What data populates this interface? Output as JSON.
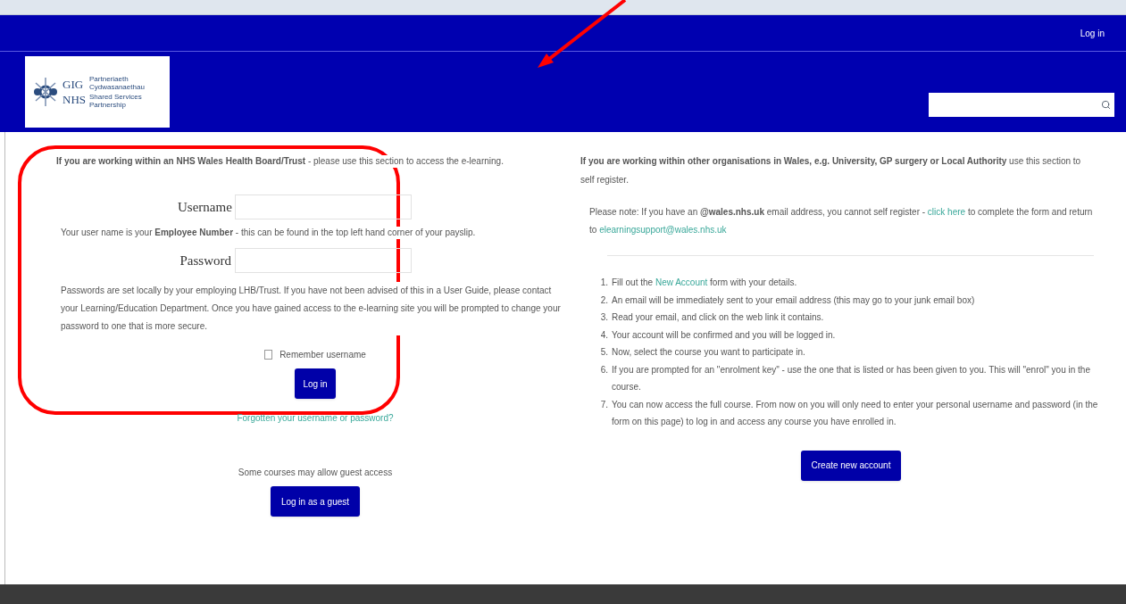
{
  "topbar": {
    "login_link": "Log in"
  },
  "logo": {
    "welsh_mark": "GIG",
    "english_mark": "NHS",
    "welsh_name": "Partneriaeth Cydwasanaethau",
    "english_name": "Shared Services Partnership"
  },
  "left": {
    "intro": "**If you are working within an NHS Wales Health Board/Trust** - please use this section to access the e-learning.",
    "username_label": "Username",
    "username_note": "Your user name is your **Employee Number** - this can be found in the top left hand corner of your payslip.",
    "password_label": "Password",
    "password_note": "Passwords are set locally by your employing LHB/Trust. If you have not been advised of this in a User Guide, please contact your Learning/Education Department. Once you have gained access to the e-learning site you will be prompted to change your password to one that is more secure.",
    "remember": {
      "label": "Remember username",
      "checked": false
    },
    "login_button": "Log in",
    "forgot_link": "Forgotten your username or password?",
    "guest_note": "Some courses may allow guest access",
    "guest_button": "Log in as a guest"
  },
  "right": {
    "intro": "**If you are working within other organisations in Wales, e.g. University, GP surgery or Local Authority** use this section to self register.",
    "note": {
      "before": "Please note: If you have an **@wales.nhs.uk** email address, you cannot self register - ",
      "link": "click here",
      "middle": " to complete the form and return to ",
      "email": "elearningsupport@wales.nhs.uk"
    },
    "steps": [
      {
        "number": "1.",
        "before": "Fill out the ",
        "link": "New Account",
        "after": " form with your details."
      },
      {
        "number": "2.",
        "before": "An email will be immediately sent to your email address (this may go to your junk email box)"
      },
      {
        "number": "3.",
        "before": "Read your email, and click on the web link it contains."
      },
      {
        "number": "4.",
        "before": "Your account will be confirmed and you will be logged in."
      },
      {
        "number": "5.",
        "before": "Now, select the course you want to participate in."
      },
      {
        "number": "6.",
        "before": "If you are prompted for an \"enrolment key\" - use the one that is listed or has been given to you. This will \"enrol\" you in the course."
      },
      {
        "number": "7.",
        "before": "You can now access the full course. From now on you will only need to enter your personal username and password (in the form on this page) to log in and access any course you have enrolled in."
      }
    ],
    "create_button": "Create new account"
  }
}
